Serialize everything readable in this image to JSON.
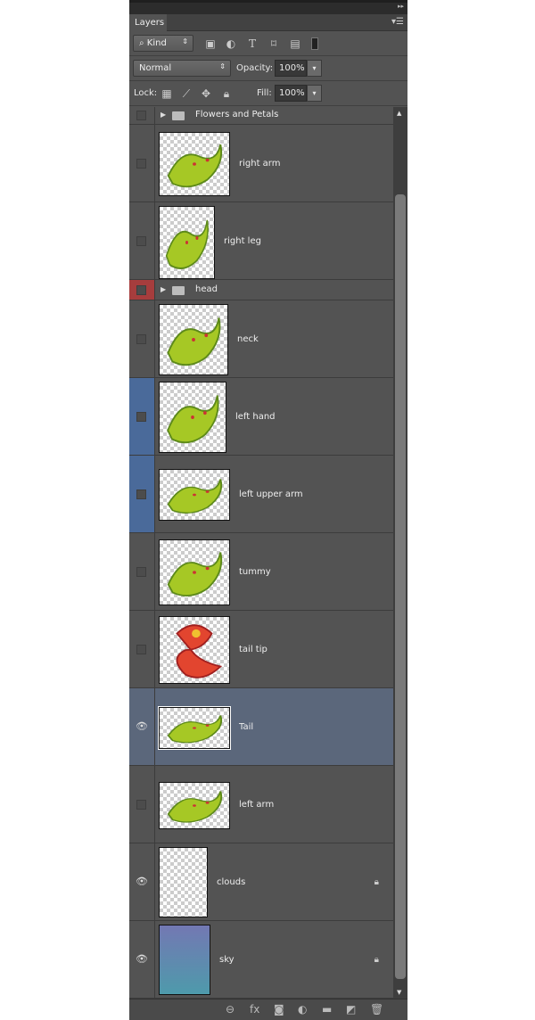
{
  "panel": {
    "tab": "Layers",
    "filter": {
      "label": "Kind"
    },
    "blend_mode": "Normal",
    "opacity_label": "Opacity:",
    "opacity": "100%",
    "lock_label": "Lock:",
    "fill_label": "Fill:",
    "fill": "100%"
  },
  "colors": {
    "selected_row": "#5b677b",
    "blue_tag": "#4a6a9a",
    "red_tag": "#a63d3d"
  },
  "layers": [
    {
      "name": "Flowers and Petals",
      "type": "group",
      "visible": false
    },
    {
      "name": "right arm",
      "type": "layer",
      "visible": false,
      "art": "green"
    },
    {
      "name": "right leg",
      "type": "layer",
      "visible": false,
      "art": "green"
    },
    {
      "name": "head",
      "type": "group",
      "visible": false,
      "tag": "red"
    },
    {
      "name": "neck",
      "type": "layer",
      "visible": false,
      "art": "green"
    },
    {
      "name": "left hand",
      "type": "layer",
      "visible": false,
      "tag": "blue",
      "art": "green"
    },
    {
      "name": "left upper arm",
      "type": "layer",
      "visible": false,
      "tag": "blue",
      "art": "green"
    },
    {
      "name": "tummy",
      "type": "layer",
      "visible": false,
      "art": "green"
    },
    {
      "name": "tail tip",
      "type": "layer",
      "visible": false,
      "art": "red"
    },
    {
      "name": "Tail",
      "type": "layer",
      "visible": true,
      "selected": true,
      "art": "green"
    },
    {
      "name": "left arm",
      "type": "layer",
      "visible": false,
      "art": "green"
    },
    {
      "name": "clouds",
      "type": "layer",
      "visible": true,
      "locked": true,
      "art": "none"
    },
    {
      "name": "sky",
      "type": "layer",
      "visible": true,
      "locked": true,
      "art": "gradient"
    }
  ],
  "footer_icons": [
    "link-icon",
    "fx-icon",
    "mask-icon",
    "adjustment-icon",
    "folder-icon",
    "new-layer-icon",
    "trash-icon"
  ]
}
